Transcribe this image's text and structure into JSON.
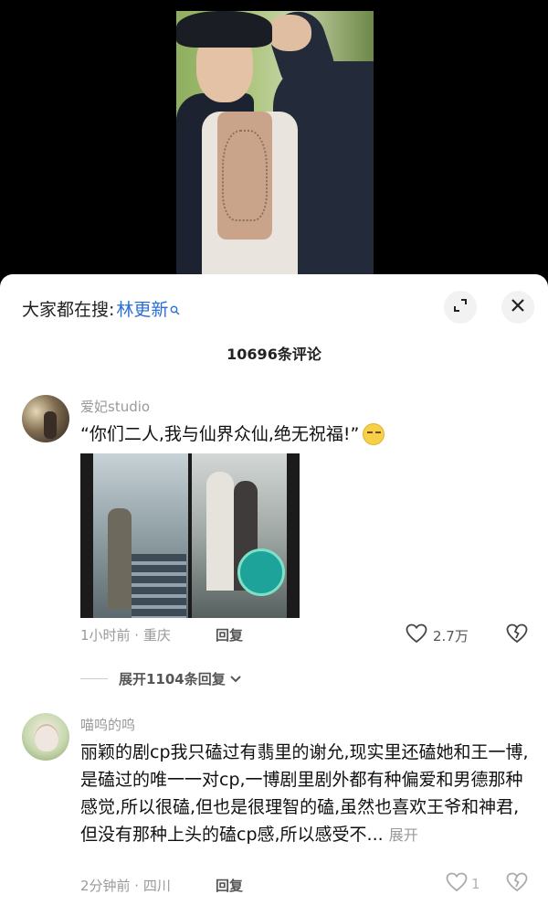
{
  "header": {
    "search_label": "大家都在搜:",
    "search_term": "林更新"
  },
  "comments_header": {
    "count_label": "10696条评论"
  },
  "comments": [
    {
      "username": "爱妃studio",
      "text": "“你们二人,我与仙界众仙,绝无祝福!”",
      "time_location": "1小时前 · 重庆",
      "reply_label": "回复",
      "likes": "2.7万",
      "replies_expand": "展开1104条回复"
    },
    {
      "username": "喵呜的呜",
      "text": "丽颖的剧cp我只磕过有翡里的谢允,现实里还磕她和王一博,是磕过的唯一一对cp,一博剧里剧外都有种偏爱和男德那种感觉,所以很磕,但也是很理智的磕,虽然也喜欢王爷和神君,但没有那种上头的磕cp感,所以感受不...",
      "expand_label": "展开",
      "time_location": "2分钟前 · 四川",
      "reply_label": "回复",
      "likes": "1"
    }
  ],
  "icons": {
    "expand": "expand-icon",
    "close": "close-icon",
    "like": "heart-icon",
    "dislike": "broken-heart-icon"
  }
}
